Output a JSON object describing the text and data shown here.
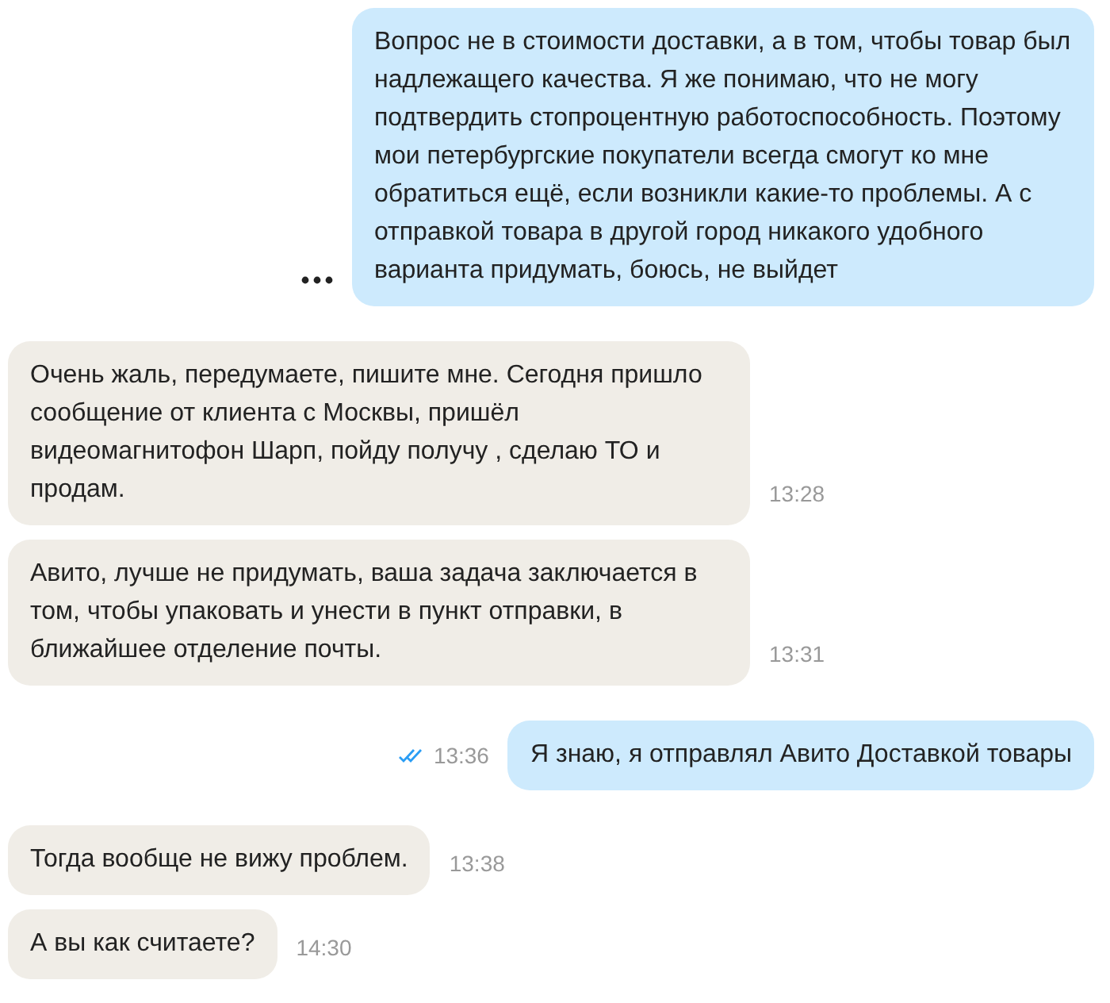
{
  "messages": [
    {
      "kind": "outgoing",
      "text": "Вопрос не в стоимости доставки, а в том, чтобы товар был надлежащего качества. Я же понимаю, что не могу подтвердить стопроцентную работоспособность. Поэтому мои петербургские покупатели всегда смогут ко мне обратиться ещё, если возникли какие-то проблемы. А с отправкой товара в другой город никакого удобного варианта придумать, боюсь, не выйдет",
      "more_menu": true
    },
    {
      "kind": "incoming",
      "text": "Очень жаль, передумаете, пишите мне. Сегодня пришло сообщение от клиента с Москвы, пришёл видеомагнитофон Шарп, пойду получу , сделаю ТО и продам.",
      "time": "13:28"
    },
    {
      "kind": "incoming",
      "text": "Авито, лучше не придумать, ваша задача заключается в том, чтобы упаковать и унести в пункт отправки, в ближайшее отделение почты.",
      "time": "13:31"
    },
    {
      "kind": "outgoing",
      "text": "Я знаю, я отправлял Авито Доставкой товары",
      "time": "13:36",
      "read": true
    },
    {
      "kind": "incoming",
      "text": "Тогда вообще не вижу проблем.",
      "time": "13:38"
    },
    {
      "kind": "incoming",
      "text": "А вы как считаете?",
      "time": "14:30"
    }
  ]
}
